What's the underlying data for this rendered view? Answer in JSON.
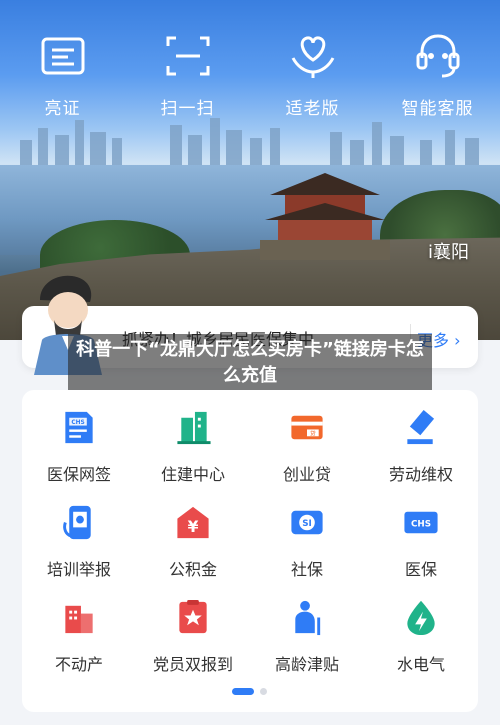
{
  "topnav": {
    "items": [
      {
        "label": "亮证",
        "icon": "id-card-icon"
      },
      {
        "label": "扫一扫",
        "icon": "scan-icon"
      },
      {
        "label": "适老版",
        "icon": "heart-hands-icon"
      },
      {
        "label": "智能客服",
        "icon": "headset-icon"
      }
    ]
  },
  "hero": {
    "city_label": "i襄阳"
  },
  "notice": {
    "text": "抓紧办！城乡居民医保集中",
    "more_label": "更多"
  },
  "caption": {
    "text": "科普一下“龙鼎大厅怎么买房卡”链接房卡怎么充值"
  },
  "services": [
    {
      "label": "医保网签",
      "icon": "chs-document-icon",
      "color": "#2f7cf6"
    },
    {
      "label": "住建中心",
      "icon": "building-icon",
      "color": "#20b38a"
    },
    {
      "label": "创业贷",
      "icon": "loan-card-icon",
      "color": "#f2682c"
    },
    {
      "label": "劳动维权",
      "icon": "gavel-icon",
      "color": "#2f7cf6"
    },
    {
      "label": "培训举报",
      "icon": "phone-scan-icon",
      "color": "#2f7cf6"
    },
    {
      "label": "公积金",
      "icon": "yuan-house-icon",
      "color": "#e94b4b"
    },
    {
      "label": "社保",
      "icon": "social-security-card-icon",
      "color": "#2f7cf6"
    },
    {
      "label": "医保",
      "icon": "chs-card-icon",
      "color": "#2f7cf6"
    },
    {
      "label": "不动产",
      "icon": "real-estate-icon",
      "color": "#e94b4b"
    },
    {
      "label": "党员双报到",
      "icon": "party-badge-icon",
      "color": "#e94b4b"
    },
    {
      "label": "高龄津贴",
      "icon": "elderly-icon",
      "color": "#2f7cf6"
    },
    {
      "label": "水电气",
      "icon": "utilities-drop-icon",
      "color": "#20b38a"
    }
  ],
  "pager": {
    "active": 1,
    "total": 2
  }
}
